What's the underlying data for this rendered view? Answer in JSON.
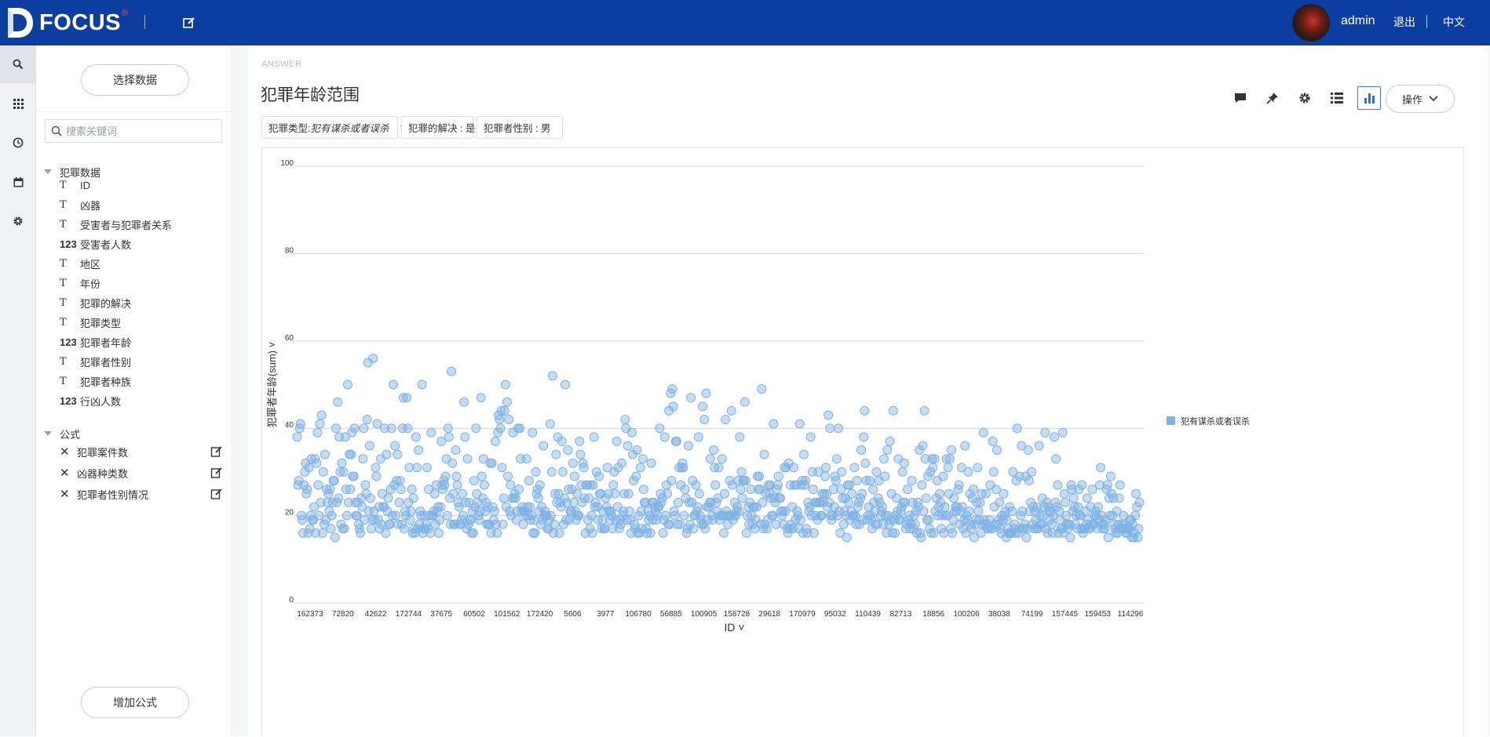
{
  "app": {
    "logo_text": "FOCUS",
    "logo_registered": "®",
    "user_name": "admin",
    "logout_label": "退出",
    "language_label": "中文"
  },
  "sidebar": {
    "select_data_label": "选择数据",
    "search_placeholder": "搜索关键词",
    "groups": [
      {
        "label": "犯罪数据",
        "fields": [
          {
            "type": "T",
            "label": "ID"
          },
          {
            "type": "T",
            "label": "凶器"
          },
          {
            "type": "T",
            "label": "受害者与犯罪者关系"
          },
          {
            "type": "123",
            "label": "受害者人数"
          },
          {
            "type": "T",
            "label": "地区"
          },
          {
            "type": "T",
            "label": "年份"
          },
          {
            "type": "T",
            "label": "犯罪的解决"
          },
          {
            "type": "T",
            "label": "犯罪类型"
          },
          {
            "type": "123",
            "label": "犯罪者年龄"
          },
          {
            "type": "T",
            "label": "犯罪者性别"
          },
          {
            "type": "T",
            "label": "犯罪者种族"
          },
          {
            "type": "123",
            "label": "行凶人数"
          }
        ]
      },
      {
        "label": "公式",
        "formulas": [
          {
            "label": "犯罪案件数"
          },
          {
            "label": "凶器种类数"
          },
          {
            "label": "犯罪者性别情况"
          }
        ]
      }
    ],
    "add_formula_label": "增加公式"
  },
  "answer": {
    "tag": "ANSWER",
    "title": "犯罪年龄范围",
    "operations_label": "操作",
    "filters": [
      {
        "label": "犯罪类型: ",
        "value": "犯有谋杀或者误杀",
        "dropdown": true
      },
      {
        "label": "犯罪的解决 : 是",
        "value": "",
        "dropdown": false
      },
      {
        "label": "犯罪者性别 : 男",
        "value": "",
        "dropdown": false
      }
    ],
    "toolbar_icons": [
      "comment-icon",
      "pin-icon",
      "settings-icon",
      "table-view-icon",
      "chart-view-icon"
    ]
  },
  "chart_data": {
    "type": "scatter",
    "title": "",
    "xlabel": "ID",
    "ylabel": "犯罪者年龄(sum)",
    "ylim": [
      0,
      100
    ],
    "yticks": [
      0,
      20,
      40,
      60,
      80,
      100
    ],
    "x_tick_labels": [
      "162373",
      "72820",
      "42622",
      "172744",
      "37675",
      "60502",
      "101562",
      "172420",
      "5606",
      "3977",
      "106780",
      "56885",
      "100905",
      "158728",
      "29618",
      "170979",
      "95032",
      "110439",
      "82713",
      "18856",
      "100206",
      "38038",
      "74199",
      "157445",
      "159453",
      "114296"
    ],
    "grid": true,
    "legend_position": "right",
    "series": [
      {
        "name": "犯有谋杀或者误杀",
        "color": "#7fb2e5",
        "point_count": 1000,
        "y_values": [
          38,
          27,
          28,
          40,
          41,
          20,
          19,
          16,
          27,
          30,
          32,
          25,
          26,
          16,
          31,
          17,
          20,
          33,
          19,
          19,
          22,
          33,
          16,
          32,
          39,
          27,
          20,
          41,
          23,
          43,
          16,
          30,
          18,
          34,
          19,
          26,
          23,
          25,
          21,
          26,
          17,
          20,
          23,
          28,
          28,
          15,
          40,
          23,
          46,
          24,
          38,
          30,
          18,
          32,
          17,
          30,
          17,
          38,
          26,
          20,
          50,
          23,
          34,
          26,
          34,
          39,
          29,
          29,
          40,
          23,
          20,
          20,
          23,
          18,
          17,
          16,
          24,
          22,
          33,
          40,
          19,
          27,
          25,
          42,
          55,
          21,
          36,
          24,
          17,
          19,
          56,
          21,
          19,
          31,
          29,
          41,
          19,
          22,
          17,
          33,
          18,
          25,
          22,
          22,
          40,
          16,
          34,
          21,
          24,
          18,
          18,
          26,
          40,
          20,
          50,
          27,
          36,
          20,
          28,
          34,
          18,
          23,
          28,
          26,
          18,
          40,
          47,
          17,
          21,
          20,
          47,
          40,
          23,
          31,
          19,
          21,
          26,
          16,
          24,
          17,
          16,
          38,
          31,
          17,
          35,
          18,
          21,
          20,
          50,
          16,
          17,
          20,
          17,
          18,
          31,
          17,
          26,
          20,
          16,
          39,
          20,
          20,
          21,
          25,
          18,
          27,
          21,
          22,
          16,
          19,
          22,
          37,
          27,
          26,
          28,
          27,
          29,
          33,
          20,
          40,
          38,
          24,
          18,
          53,
          32,
          25,
          18,
          18,
          35,
          29,
          27,
          23,
          22,
          18,
          18,
          19,
          25,
          20,
          46,
          38,
          23,
          17,
          33,
          18,
          23,
          19,
          19,
          16,
          21,
          16,
          28,
          22,
          40,
          25,
          23,
          20,
          19,
          21,
          47,
          29,
          24,
          33,
          27,
          21,
          23,
          18,
          22,
          18,
          18,
          32,
          16,
          32,
          22,
          19,
          21,
          37,
          18,
          16,
          39,
          43,
          42,
          40,
          44,
          31,
          18,
          24,
          44,
          50,
          22,
          46,
          29,
          42,
          21,
          27,
          20,
          24,
          39,
          24,
          25,
          24,
          19,
          21,
          40,
          26,
          40,
          33,
          21,
          22,
          18,
          21,
          21,
          20,
          33,
          22,
          20,
          28,
          22,
          19,
          20,
          39,
          16,
          19,
          16,
          30,
          25,
          26,
          24,
          21,
          27,
          18,
          22,
          19,
          36,
          20,
          21,
          20,
          20,
          17,
          17,
          19,
          41,
          20,
          30,
          52,
          16,
          18,
          25,
          34,
          23,
          38,
          25,
          16,
          23,
          22,
          37,
          30,
          18,
          24,
          50,
          19,
          23,
          35,
          26,
          19,
          21,
          21,
          26,
          32,
          23,
          29,
          21,
          19,
          25,
          20,
          20,
          37,
          34,
          27,
          23,
          32,
          31,
          24,
          16,
          27,
          27,
          19,
          24,
          17,
          27,
          20,
          16,
          27,
          38,
          22,
          23,
          30,
          22,
          19,
          29,
          25,
          25,
          17,
          19,
          21,
          17,
          17,
          24,
          22,
          31,
          25,
          21,
          19,
          21,
          20,
          17,
          27,
          30,
          25,
          19,
          37,
          22,
          31,
          17,
          19,
          18,
          32,
          20,
          21,
          25,
          42,
          40,
          19,
          36,
          25,
          21,
          19,
          16,
          39,
          34,
          28,
          18,
          17,
          29,
          35,
          16,
          20,
          16,
          31,
          21,
          17,
          33,
          26,
          23,
          23,
          17,
          16,
          21,
          19,
          20,
          16,
          32,
          23,
          19,
          23,
          22,
          21,
          19,
          20,
          22,
          22,
          40,
          25,
          23,
          24,
          16,
          19,
          38,
          20,
          27,
          25,
          18,
          44,
          18,
          48,
          28,
          49,
          45,
          21,
          20,
          37,
          37,
          18,
          23,
          31,
          18,
          27,
          31,
          32,
          31,
          20,
          26,
          24,
          16,
          17,
          36,
          23,
          18,
          47,
          23,
          28,
          17,
          20,
          20,
          27,
          21,
          22,
          38,
          25,
          20,
          19,
          18,
          45,
          18,
          42,
          17,
          48,
          22,
          19,
          22,
          23,
          33,
          23,
          20,
          19,
          35,
          31,
          27,
          23,
          21,
          24,
          31,
          19,
          20,
          20,
          33,
          20,
          16,
          25,
          42,
          21,
          20,
          18,
          20,
          28,
          20,
          44,
          27,
          19,
          20,
          23,
          20,
          21,
          22,
          28,
          21,
          38,
          26,
          30,
          24,
          28,
          28,
          46,
          28,
          16,
          20,
          22,
          18,
          23,
          26,
          20,
          18,
          22,
          22,
          17,
          19,
          22,
          29,
          26,
          29,
          26,
          18,
          49,
          23,
          17,
          34,
          18,
          25,
          17,
          19,
          27,
          25,
          27,
          24,
          20,
          20,
          41,
          24,
          23,
          18,
          26,
          27,
          29,
          24,
          24,
          21,
          20,
          21,
          18,
          31,
          21,
          31,
          17,
          16,
          32,
          17,
          27,
          18,
          22,
          17,
          31,
          27,
          19,
          27,
          21,
          20,
          17,
          41,
          19,
          27,
          28,
          16,
          34,
          27,
          28,
          17,
          16,
          23,
          21,
          22,
          38,
          20,
          30,
          26,
          16,
          23,
          20,
          23,
          19,
          30,
          23,
          23,
          20,
          20,
          25,
          23,
          25,
          29,
          31,
          25,
          22,
          43,
          23,
          40,
          20,
          19,
          20,
          26,
          22,
          29,
          28,
          33,
          20,
          40,
          21,
          16,
          26,
          30,
          24,
          18,
          21,
          24,
          20,
          15,
          27,
          23,
          27,
          19,
          21,
          25,
          20,
          20,
          31,
          20,
          18,
          28,
          22,
          23,
          18,
          24,
          35,
          25,
          19,
          38,
          44,
          32,
          28,
          19,
          20,
          22,
          28,
          20,
          19,
          17,
          26,
          23,
          21,
          18,
          30,
          18,
          24,
          28,
          23,
          20,
          21,
          22,
          18,
          33,
          29,
          20,
          16,
          35,
          20,
          18,
          37,
          19,
          25,
          16,
          44,
          19,
          16,
          20,
          24,
          21,
          33,
          19,
          19,
          21,
          22,
          30,
          23,
          32,
          23,
          17,
          18,
          26,
          19,
          20,
          17,
          18,
          28,
          23,
          17,
          20,
          18,
          21,
          16,
          23,
          22,
          35,
          16,
          15,
          27,
          36,
          21,
          44,
          33,
          24,
          19,
          29,
          19,
          17,
          30,
          16,
          33,
          31,
          16,
          33,
          21,
          24,
          28,
          20,
          22,
          25,
          23,
          17,
          20,
          29,
          16,
          22,
          20,
          33,
          20,
          31,
          25,
          33,
          17,
          35,
          16,
          19,
          24,
          21,
          22,
          21,
          22,
          26,
          27,
          18,
          21,
          31,
          22,
          17,
          19,
          36,
          16,
          20,
          19,
          30,
          21,
          25,
          18,
          17,
          24,
          26,
          15,
          18,
          19,
          23,
          31,
          21,
          19,
          23,
          16,
          25,
          18,
          39,
          19,
          18,
          25,
          18,
          17,
          17,
          19,
          27,
          17,
          17,
          37,
          30,
          22,
          18,
          26,
          35,
          18,
          19,
          23,
          17,
          16,
          20,
          19,
          25,
          20,
          21,
          15,
          19,
          17,
          16,
          22,
          16,
          16,
          21,
          30,
          17,
          18,
          16,
          28,
          40,
          16,
          17,
          29,
          20,
          36,
          21,
          17,
          17,
          18,
          29,
          15,
          17,
          35,
          28,
          21,
          23,
          30,
          18,
          22,
          17,
          21,
          19,
          17,
          22,
          17,
          36,
          20,
          18,
          18,
          24,
          20,
          22,
          39,
          17,
          23,
          16,
          22,
          21,
          19,
          21,
          18,
          16,
          20,
          38,
          23,
          33,
          22,
          27,
          16,
          21,
          19,
          17,
          17,
          39,
          16,
          25,
          23,
          20,
          18,
          17,
          18,
          18,
          15,
          27,
          26,
          21,
          24,
          22,
          18,
          20,
          17,
          22,
          26,
          20,
          20,
          17,
          27,
          16,
          17,
          17,
          21,
          18,
          24,
          19,
          17,
          17,
          22,
          18,
          26,
          18,
          18,
          20,
          21,
          20,
          17,
          22,
          19,
          27,
          31,
          20,
          18,
          17,
          18,
          17,
          19,
          26,
          27,
          15,
          24,
          20,
          29,
          25,
          20,
          24,
          18,
          17,
          16,
          21,
          16,
          18,
          24,
          27,
          17,
          17,
          18,
          20,
          18,
          17,
          16,
          16,
          17,
          17,
          17,
          19,
          19,
          15,
          18,
          15,
          16,
          20,
          25,
          22,
          15,
          17,
          23,
          17,
          22,
          17,
          19,
          16,
          20,
          18,
          21,
          20,
          19,
          17,
          18,
          16,
          21,
          22,
          18,
          21,
          17,
          18,
          30,
          22,
          16,
          18,
          21,
          19,
          20,
          19,
          17,
          20,
          17,
          16,
          20,
          16,
          17,
          20,
          16,
          17,
          16,
          18,
          21,
          27,
          18,
          17,
          17,
          17,
          19,
          18,
          16,
          17,
          18,
          18,
          22,
          26,
          16,
          20,
          17,
          18,
          22,
          17,
          20,
          16,
          25,
          16,
          17,
          17,
          17,
          16,
          16,
          18,
          23,
          17,
          18,
          17,
          18,
          17,
          17,
          17,
          20
        ]
      }
    ]
  }
}
